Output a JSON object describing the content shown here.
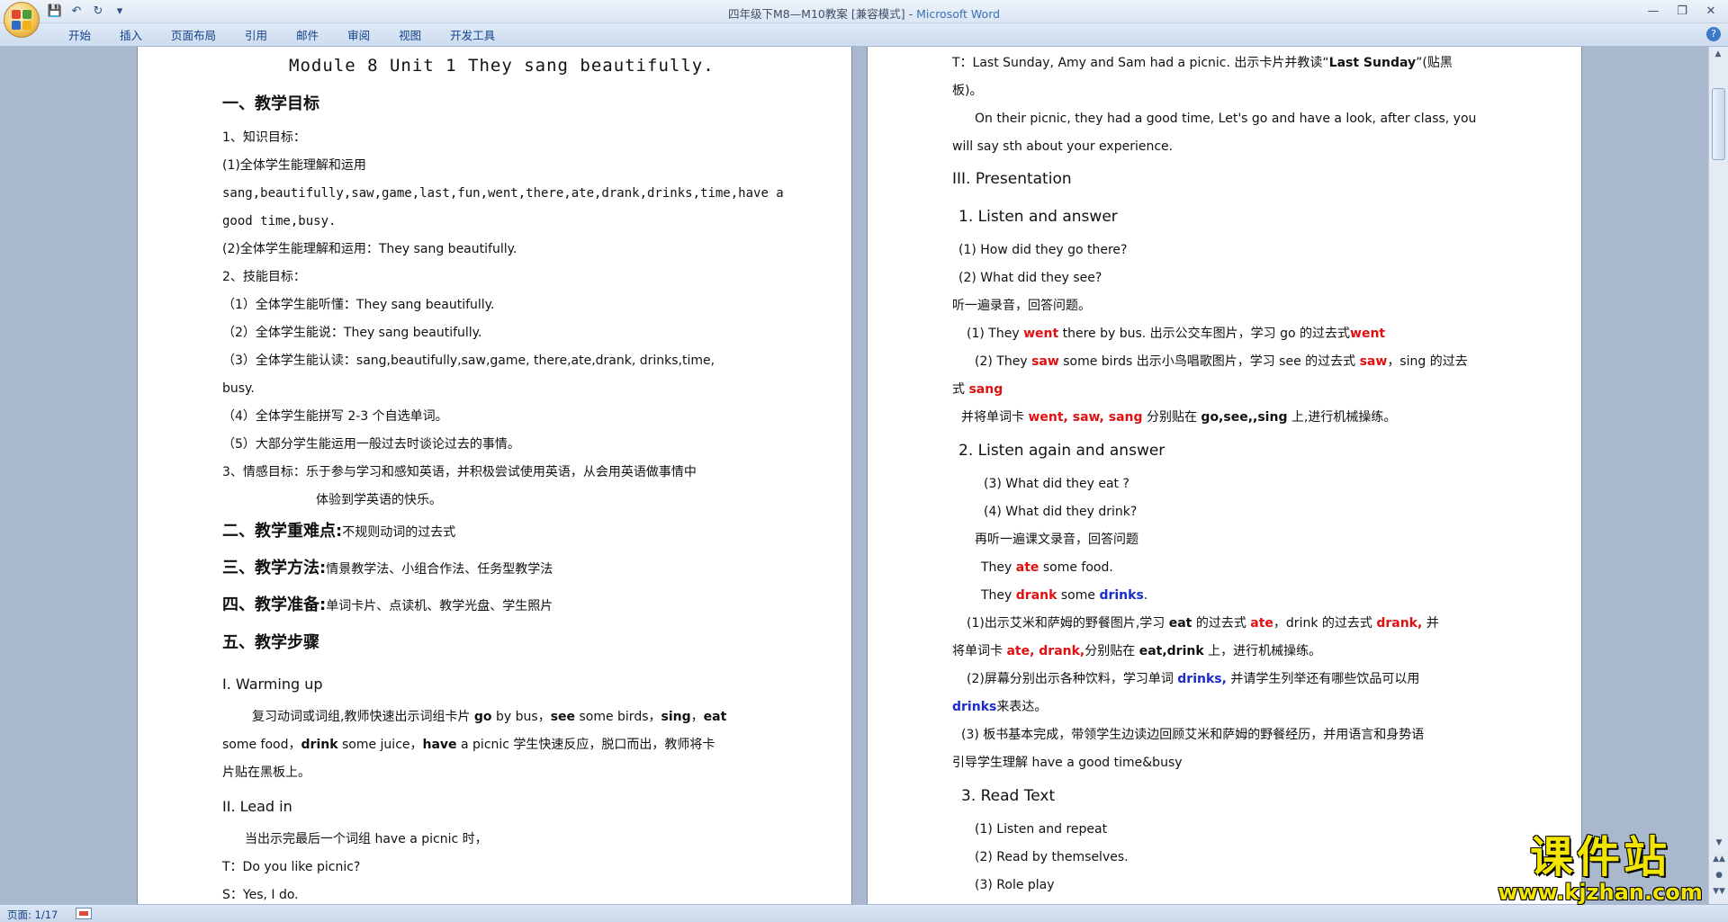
{
  "window": {
    "title_doc": "四年级下M8—M10教案 [兼容模式] - ",
    "title_app": "Microsoft Word"
  },
  "colors": {
    "accent": "#15428b",
    "red_text": "#e01010",
    "blue_text": "#1a2bd0",
    "watermark": "#f2e500"
  },
  "quick_access": {
    "icons": [
      "save-icon",
      "undo-icon",
      "redo-icon",
      "customize-icon"
    ]
  },
  "ribbon": {
    "tabs": [
      "开始",
      "插入",
      "页面布局",
      "引用",
      "邮件",
      "审阅",
      "视图",
      "开发工具"
    ]
  },
  "left_page": {
    "title": "Module 8 Unit 1 They sang beautifully.",
    "h1": "一、教学目标",
    "l1": "1、知识目标：",
    "l2": "(1)全体学生能理解和运用",
    "l3": "sang,beautifully,saw,game,last,fun,went,there,ate,drank,drinks,time,have a",
    "l4": "good time,busy.",
    "l5": "(2)全体学生能理解和运用：They sang beautifully.",
    "l6": "2、技能目标：",
    "l7": "（1）全体学生能听懂：They sang beautifully.",
    "l8": "（2）全体学生能说：They sang beautifully.",
    "l9": "（3）全体学生能认读：sang,beautifully,saw,game, there,ate,drank, drinks,time,",
    "l10": "busy.",
    "l11": "（4）全体学生能拼写 2-3 个自选单词。",
    "l12": "（5）大部分学生能运用一般过去时谈论过去的事情。",
    "l13": "3、情感目标：乐于参与学习和感知英语，并积极尝试使用英语，从会用英语做事情中",
    "l14": "体验到学英语的快乐。",
    "h2": "二、教学重难点:",
    "h2_text": "不规则动词的过去式",
    "h3": "三、教学方法:",
    "h3_text": "情景教学法、小组合作法、任务型教学法",
    "h4": "四、教学准备:",
    "h4_text": "单词卡片、点读机、教学光盘、学生照片",
    "h5": "五、教学步骤",
    "warm": "I. Warming up",
    "w1_a": "复习动词或词组,教师快速出示词组卡片 ",
    "w1_go": "go",
    "w1_b": " by bus，",
    "w1_see": "see",
    "w1_c": " some birds，",
    "w1_sing": "sing",
    "w1_d": "，",
    "w1_eat": "eat",
    "w2_a": "some food，",
    "w2_drink": "drink",
    "w2_b": " some juice，",
    "w2_have": "have",
    "w2_c": " a picnic 学生快速反应，脱口而出，教师将卡",
    "w3": "片贴在黑板上。",
    "lead": "II. Lead in",
    "le1": "当出示完最后一个词组 have a picnic 时，",
    "le2": "T：Do you like picnic?",
    "le3": "S：Yes, I do."
  },
  "right_page": {
    "r1_a": "T：Last Sunday, Amy and Sam had a picnic. 出示卡片并教读“",
    "r1_b": "Last Sunday",
    "r1_c": "”(贴黑",
    "r2": "板)。",
    "r3": "On their picnic, they had a good time, Let's go and have a look, after class, you",
    "r4": "will say sth about your experience.",
    "pres": "III. Presentation",
    "la": "1. Listen and answer",
    "q1": "(1) How did they go there?",
    "q2": "(2) What did they see?",
    "r5": "听一遍录音，回答问题。",
    "a1_a": "(1) They ",
    "a1_went": "went",
    "a1_b": " there by bus. 出示公交车图片，学习 go 的过去式",
    "a1_went2": "went",
    "a2_a": "(2) They ",
    "a2_saw": "saw",
    "a2_b": " some birds 出示小鸟唱歌图片，学习 see 的过去式 ",
    "a2_saw2": "saw",
    "a2_c": "，sing 的过去",
    "a3_a": "式 ",
    "a3_sang": "sang",
    "a4_a": "并将单词卡 ",
    "a4_words": "went, saw, sang",
    "a4_b": " 分别贴在 ",
    "a4_c": "go,see,,sing",
    "a4_d": " 上,进行机械操练。",
    "lag": "2. Listen again and answer",
    "q3": "(3) What did they eat ?",
    "q4": "(4) What did they drink?",
    "r6": "再听一遍课文录音，回答问题",
    "a5_a": "They ",
    "a5_ate": "ate",
    "a5_b": " some food.",
    "a6_a": "They ",
    "a6_drank": "drank",
    "a6_b": " some ",
    "a6_drinks": "drinks",
    "a6_c": ".",
    "p1_a": "(1)出示艾米和萨姆的野餐图片,学习 ",
    "p1_eat": "eat",
    "p1_b": " 的过去式 ",
    "p1_ate": "ate",
    "p1_c": "，drink 的过去式 ",
    "p1_drank": "drank,",
    "p1_d": " 并",
    "p2_a": "将单词卡 ",
    "p2_words": "ate, drank,",
    "p2_b": "分别贴在 ",
    "p2_c": "eat,drink",
    "p2_d": " 上，进行机械操练。",
    "p3_a": "(2)屏幕分别出示各种饮料，学习单词 ",
    "p3_drinks": "drinks,",
    "p3_b": " 并请学生列举还有哪些饮品可以用",
    "p4_drinks": "drinks",
    "p4_b": "来表达。",
    "p5": "(3) 板书基本完成，带领学生边读边回顾艾米和萨姆的野餐经历，并用语言和身势语",
    "p6": "引导学生理解 have a good time&busy",
    "rt": "3. Read Text",
    "rt1": "(1) Listen and repeat",
    "rt2": "(2) Read by themselves.",
    "rt3": "(3) Role play"
  },
  "status": {
    "page": "页面: 1/17"
  },
  "watermark": {
    "cn": "课件站",
    "url": "www.kjzhan.com"
  }
}
